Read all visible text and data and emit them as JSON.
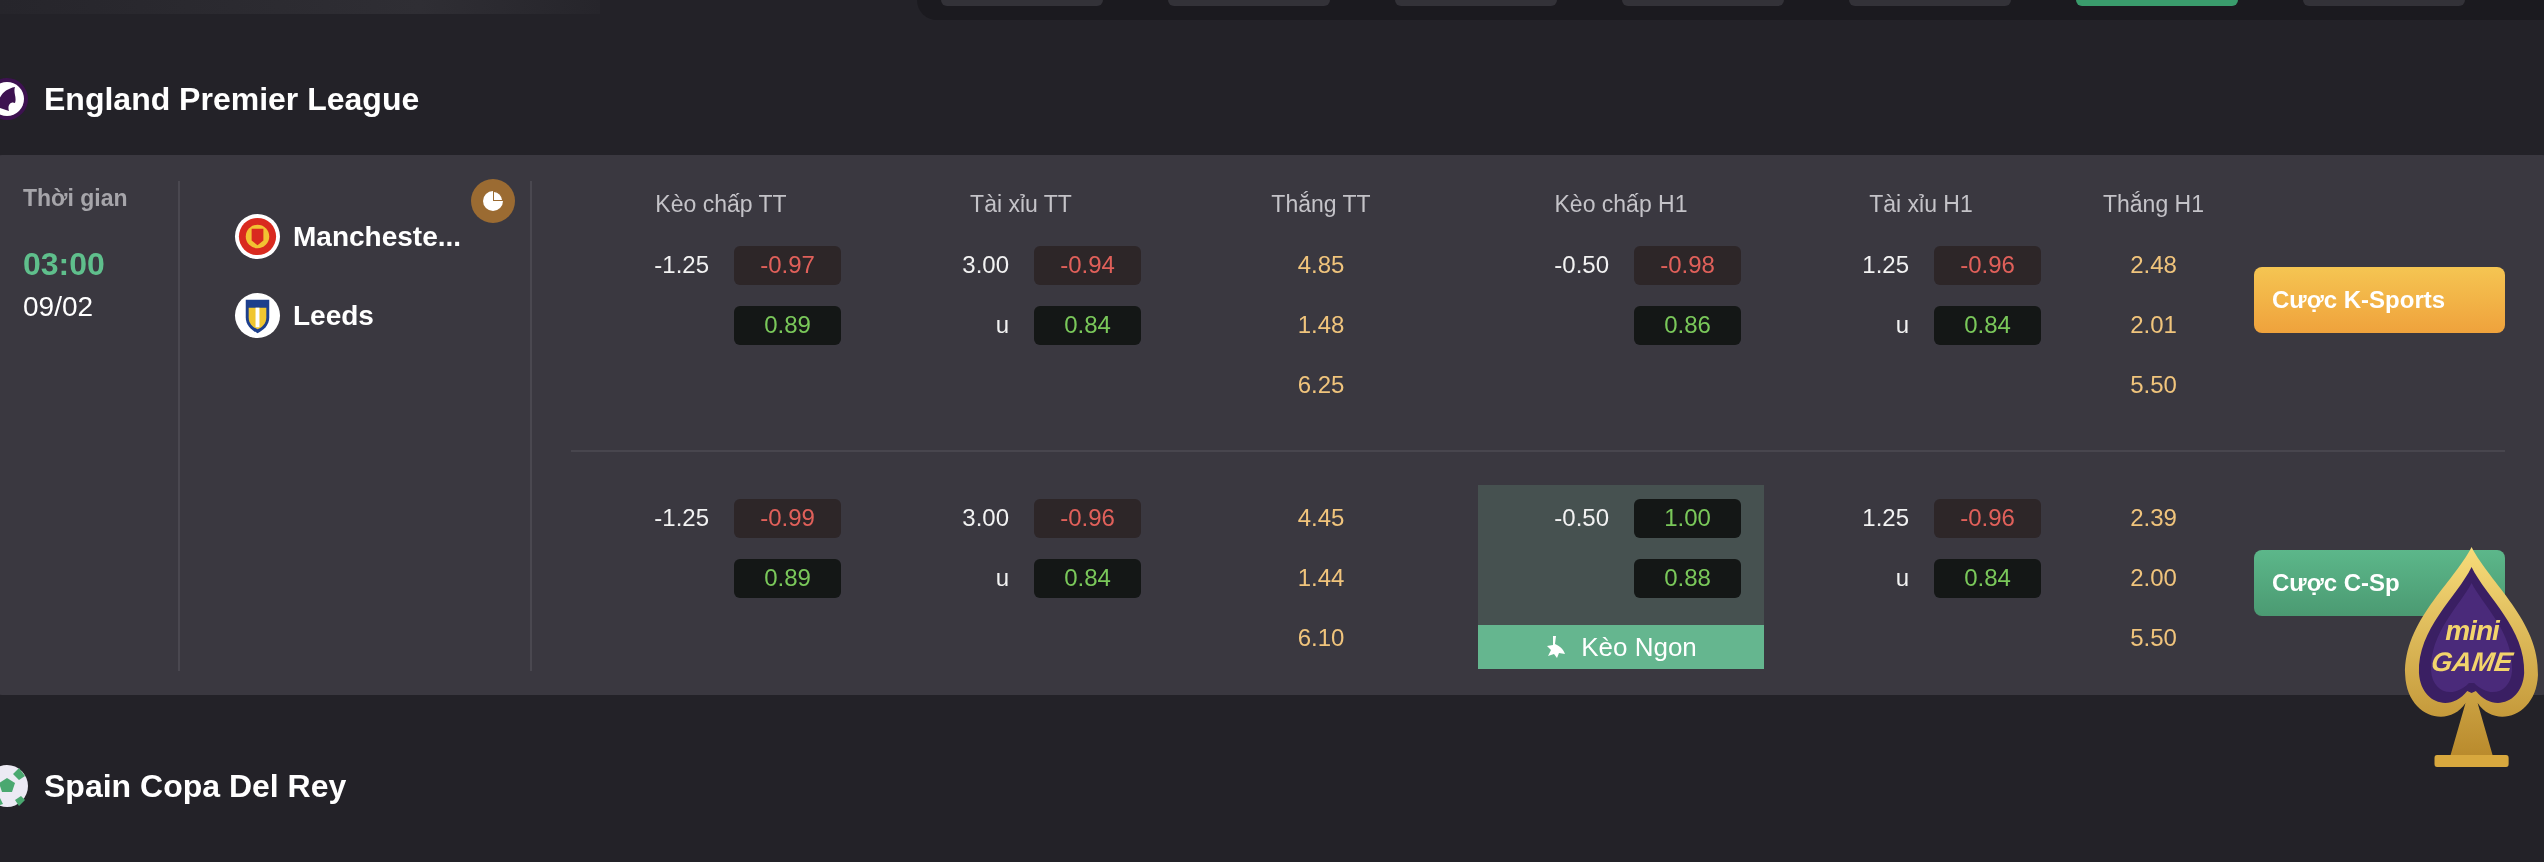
{
  "top_tabs": [
    {
      "selected": false
    },
    {
      "selected": false
    },
    {
      "selected": false
    },
    {
      "selected": false
    },
    {
      "selected": false
    },
    {
      "selected": true
    },
    {
      "selected": false
    }
  ],
  "leagues": [
    {
      "name": "England Premier League",
      "matches": [
        {
          "time_label": "Thời gian",
          "time": "03:00",
          "date": "09/02",
          "teams": [
            {
              "name": "Mancheste..."
            },
            {
              "name": "Leeds"
            }
          ],
          "markets": [
            "Kèo chấp TT",
            "Tài xỉu TT",
            "Thắng TT",
            "Kèo chấp H1",
            "Tài xỉu H1",
            "Thắng H1"
          ],
          "rows": [
            {
              "cells": [
                {
                  "kind": "pair",
                  "featured": false,
                  "lines": [
                    {
                      "label": "-1.25",
                      "odd": "-0.97",
                      "negative": true
                    },
                    {
                      "odd": "0.89",
                      "negative": false
                    }
                  ]
                },
                {
                  "kind": "pair",
                  "featured": false,
                  "lines": [
                    {
                      "label": "3.00",
                      "odd": "-0.94",
                      "negative": true
                    },
                    {
                      "label": "u",
                      "odd": "0.84",
                      "negative": false
                    }
                  ]
                },
                {
                  "kind": "win",
                  "values": [
                    "4.85",
                    "1.48",
                    "6.25"
                  ]
                },
                {
                  "kind": "pair",
                  "featured": false,
                  "lines": [
                    {
                      "label": "-0.50",
                      "odd": "-0.98",
                      "negative": true
                    },
                    {
                      "odd": "0.86",
                      "negative": false
                    }
                  ]
                },
                {
                  "kind": "pair",
                  "featured": false,
                  "lines": [
                    {
                      "label": "1.25",
                      "odd": "-0.96",
                      "negative": true
                    },
                    {
                      "label": "u",
                      "odd": "0.84",
                      "negative": false
                    }
                  ]
                },
                {
                  "kind": "win",
                  "values": [
                    "2.48",
                    "2.01",
                    "5.50"
                  ]
                }
              ],
              "button": {
                "label": "Cược K-Sports",
                "kind": "primary"
              }
            },
            {
              "cells": [
                {
                  "kind": "pair",
                  "featured": false,
                  "lines": [
                    {
                      "label": "-1.25",
                      "odd": "-0.99",
                      "negative": true
                    },
                    {
                      "odd": "0.89",
                      "negative": false
                    }
                  ]
                },
                {
                  "kind": "pair",
                  "featured": false,
                  "lines": [
                    {
                      "label": "3.00",
                      "odd": "-0.96",
                      "negative": true
                    },
                    {
                      "label": "u",
                      "odd": "0.84",
                      "negative": false
                    }
                  ]
                },
                {
                  "kind": "win",
                  "values": [
                    "4.45",
                    "1.44",
                    "6.10"
                  ]
                },
                {
                  "kind": "pair",
                  "featured": true,
                  "badge": "Kèo Ngon",
                  "lines": [
                    {
                      "label": "-0.50",
                      "odd": "1.00",
                      "negative": false
                    },
                    {
                      "odd": "0.88",
                      "negative": false
                    }
                  ]
                },
                {
                  "kind": "pair",
                  "featured": false,
                  "lines": [
                    {
                      "label": "1.25",
                      "odd": "-0.96",
                      "negative": true
                    },
                    {
                      "label": "u",
                      "odd": "0.84",
                      "negative": false
                    }
                  ]
                },
                {
                  "kind": "win",
                  "values": [
                    "2.39",
                    "2.00",
                    "5.50"
                  ]
                }
              ],
              "button": {
                "label": "Cược C-Sp",
                "kind": "secondary"
              }
            }
          ]
        }
      ]
    },
    {
      "name": "Spain Copa Del Rey"
    }
  ],
  "minigame": {
    "line1": "mini",
    "line2": "GAME"
  }
}
